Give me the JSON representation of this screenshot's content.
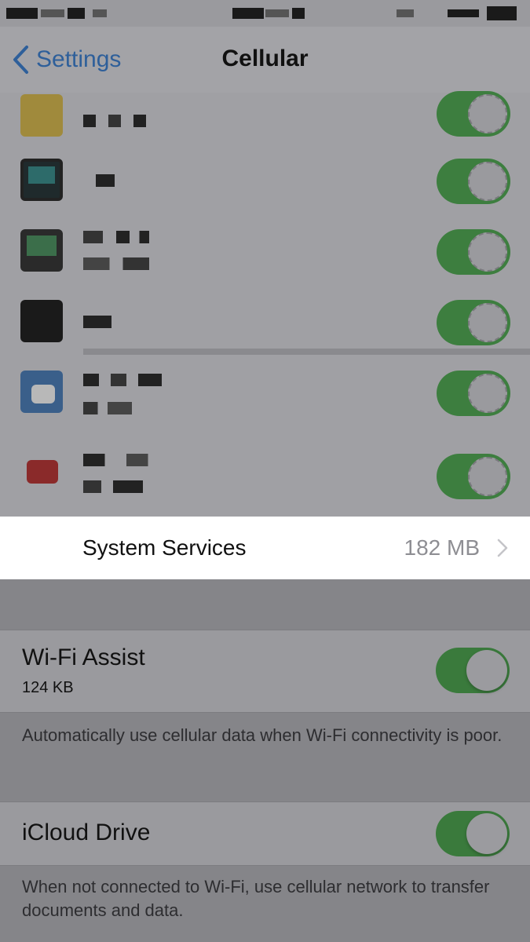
{
  "nav": {
    "back_label": "Settings",
    "title": "Cellular"
  },
  "system_services": {
    "label": "System Services",
    "value": "182 MB"
  },
  "wifi_assist": {
    "title": "Wi-Fi Assist",
    "subtitle": "124 KB",
    "enabled": true,
    "note": "Automatically use cellular data when Wi-Fi connectivity is poor."
  },
  "icloud_drive": {
    "title": "iCloud Drive",
    "enabled": true,
    "note": "When not connected to Wi-Fi, use cellular network to transfer documents and data."
  },
  "colors": {
    "accent": "#2e5f9a",
    "toggle_on": "#3a7a3c",
    "highlight": "#ffffff"
  },
  "icons": [
    "back-chevron-icon",
    "disclosure-chevron-icon"
  ]
}
